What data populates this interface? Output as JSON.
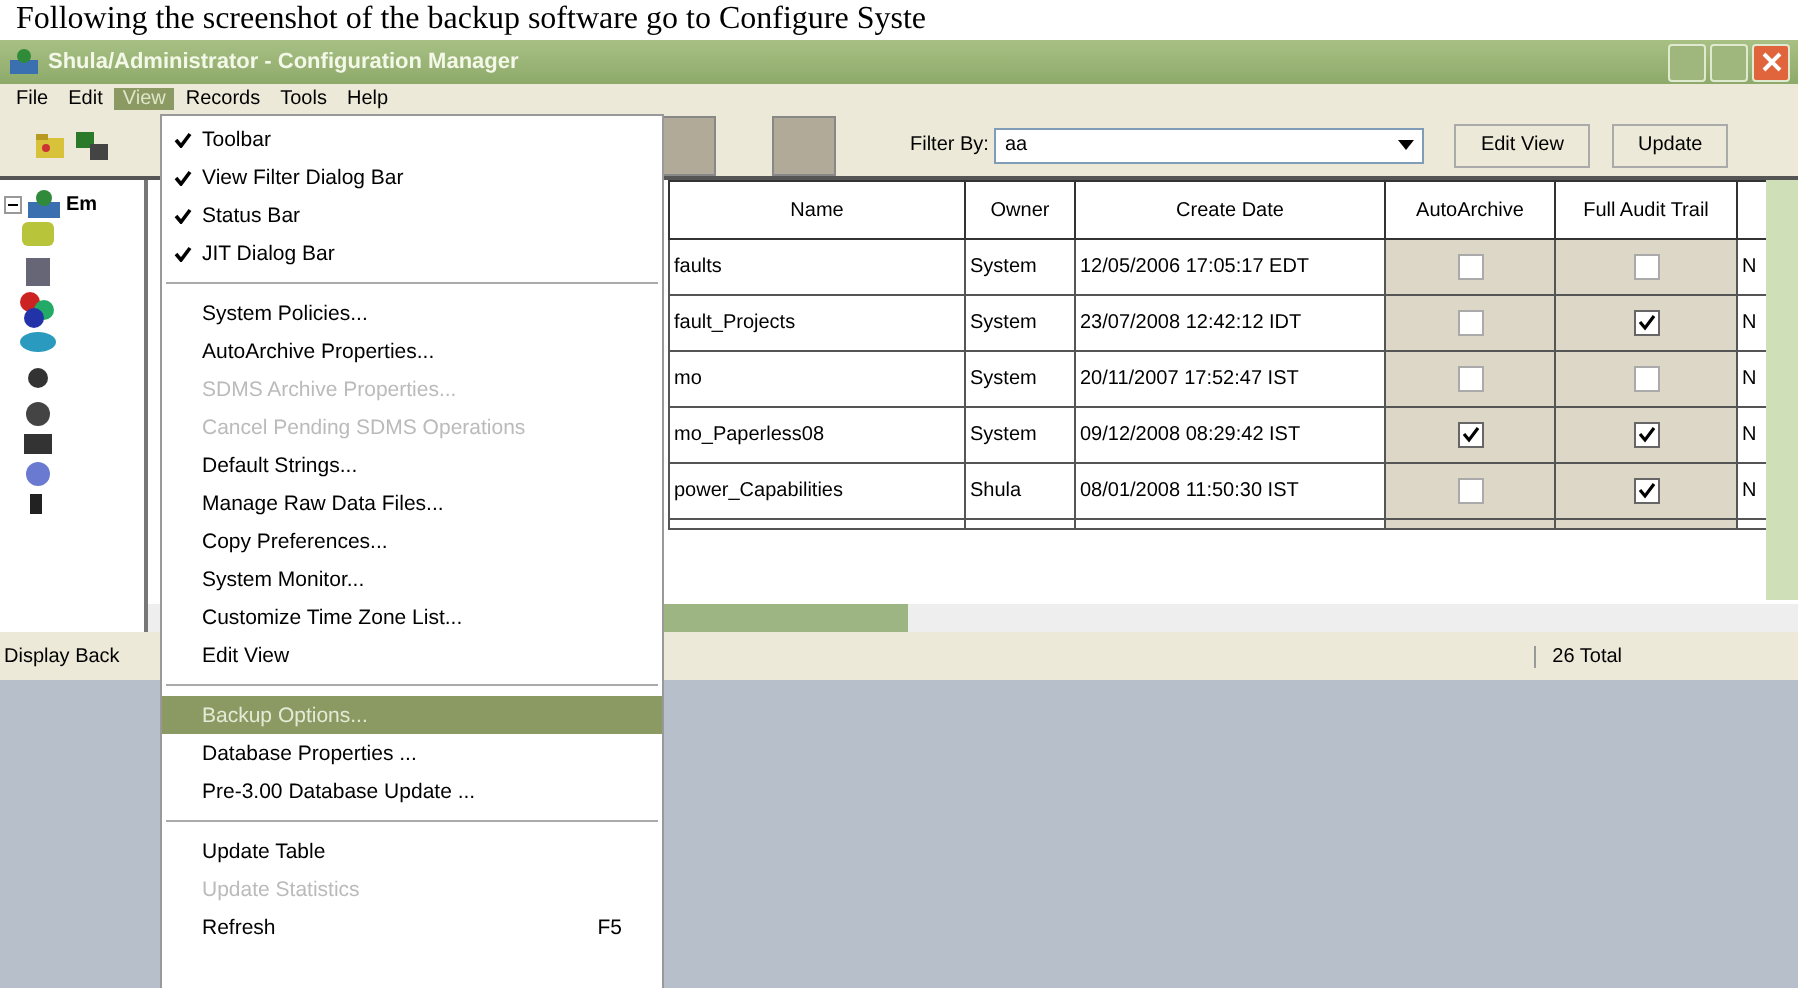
{
  "caption": "Following the screenshot of the backup software go to Configure Syste",
  "window": {
    "title": "Shula/Administrator - Configuration Manager"
  },
  "menu_bar": [
    {
      "label": "File",
      "selected": false
    },
    {
      "label": "Edit",
      "selected": false
    },
    {
      "label": "View",
      "selected": true
    },
    {
      "label": "Records",
      "selected": false
    },
    {
      "label": "Tools",
      "selected": false
    },
    {
      "label": "Help",
      "selected": false
    }
  ],
  "toolbar": {
    "filter_label": "Filter By:",
    "filter_value": "aa",
    "buttons": [
      "Edit View",
      "Update"
    ]
  },
  "tree": {
    "root_label": "Em"
  },
  "table": {
    "columns": [
      "Name",
      "Owner",
      "Create Date",
      "AutoArchive",
      "Full Audit Trail"
    ],
    "rows": [
      {
        "name": "faults",
        "owner": "System",
        "date": "12/05/2006 17:05:17 EDT",
        "auto_archive": false,
        "full_audit": false,
        "column_6": "N"
      },
      {
        "name": "fault_Projects",
        "owner": "System",
        "date": "23/07/2008 12:42:12 IDT",
        "auto_archive": false,
        "full_audit": true,
        "column_6": "N"
      },
      {
        "name": "mo",
        "owner": "System",
        "date": "20/11/2007 17:52:47 IST",
        "auto_archive": false,
        "full_audit": false,
        "column_6": "N"
      },
      {
        "name": "mo_Paperless08",
        "owner": "System",
        "date": "09/12/2008 08:29:42 IST",
        "auto_archive": true,
        "full_audit": true,
        "column_6": "N"
      },
      {
        "name": "power_Capabilities",
        "owner": "Shula",
        "date": "08/01/2008 11:50:30 IST",
        "auto_archive": false,
        "full_audit": true,
        "column_6": "N"
      }
    ]
  },
  "status_bar": {
    "left": "Display Back",
    "right": "26 Total"
  },
  "view_menu": [
    {
      "kind": "item",
      "label": "Toolbar",
      "checked": true,
      "disabled": false,
      "selected": false
    },
    {
      "kind": "item",
      "label": "View Filter Dialog Bar",
      "checked": true,
      "disabled": false,
      "selected": false
    },
    {
      "kind": "item",
      "label": "Status Bar",
      "checked": true,
      "disabled": false,
      "selected": false
    },
    {
      "kind": "item",
      "label": "JIT Dialog Bar",
      "checked": true,
      "disabled": false,
      "selected": false
    },
    {
      "kind": "separator"
    },
    {
      "kind": "item",
      "label": "System Policies...",
      "checked": false,
      "disabled": false,
      "selected": false
    },
    {
      "kind": "item",
      "label": "AutoArchive Properties...",
      "checked": false,
      "disabled": false,
      "selected": false
    },
    {
      "kind": "item",
      "label": "SDMS Archive Properties...",
      "checked": false,
      "disabled": true,
      "selected": false
    },
    {
      "kind": "item",
      "label": "Cancel Pending SDMS Operations",
      "checked": false,
      "disabled": true,
      "selected": false
    },
    {
      "kind": "item",
      "label": "Default Strings...",
      "checked": false,
      "disabled": false,
      "selected": false
    },
    {
      "kind": "item",
      "label": "Manage Raw Data Files...",
      "checked": false,
      "disabled": false,
      "selected": false
    },
    {
      "kind": "item",
      "label": "Copy Preferences...",
      "checked": false,
      "disabled": false,
      "selected": false
    },
    {
      "kind": "item",
      "label": "System Monitor...",
      "checked": false,
      "disabled": false,
      "selected": false
    },
    {
      "kind": "item",
      "label": "Customize Time Zone List...",
      "checked": false,
      "disabled": false,
      "selected": false
    },
    {
      "kind": "item",
      "label": "Edit View",
      "checked": false,
      "disabled": false,
      "selected": false
    },
    {
      "kind": "separator"
    },
    {
      "kind": "item",
      "label": "Backup Options...",
      "checked": false,
      "disabled": false,
      "selected": true
    },
    {
      "kind": "item",
      "label": "Database Properties ...",
      "checked": false,
      "disabled": false,
      "selected": false
    },
    {
      "kind": "item",
      "label": "Pre-3.00 Database Update ...",
      "checked": false,
      "disabled": false,
      "selected": false
    },
    {
      "kind": "separator"
    },
    {
      "kind": "item",
      "label": "Update Table",
      "checked": false,
      "disabled": false,
      "selected": false
    },
    {
      "kind": "item",
      "label": "Update Statistics",
      "checked": false,
      "disabled": true,
      "selected": false
    },
    {
      "kind": "item",
      "label": "Refresh",
      "shortcut": "F5",
      "checked": false,
      "disabled": false,
      "selected": false
    }
  ]
}
